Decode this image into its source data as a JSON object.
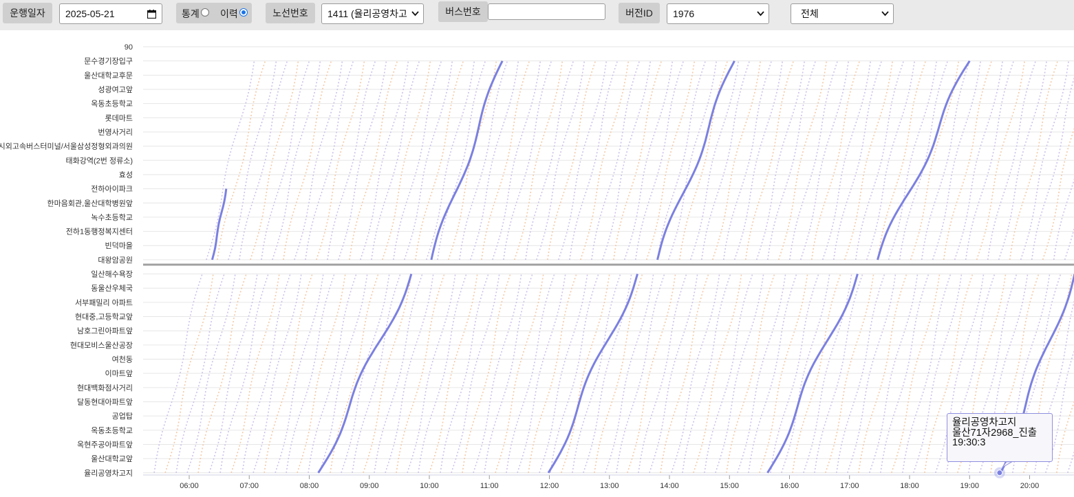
{
  "toolbar": {
    "date_label": "운행일자",
    "date_value": "2025-05-21",
    "stat_label": "통계",
    "history_label": "이력",
    "history_selected": true,
    "route_label": "노선번호",
    "route_value": "1411 (율리공영차고",
    "bus_label": "버스번호",
    "bus_value": "",
    "version_label": "버전ID",
    "version_value": "1976",
    "filter_value": "전체"
  },
  "tooltip": {
    "line1": "율리공영차고지",
    "line2": "울산71자2968_진출",
    "line3": "19:30:3"
  },
  "colors": {
    "highlight": "#7b80e0",
    "faint_purple": "#c7b9e8",
    "faint_orange": "#f3c39c",
    "gridline": "#e6e6e6",
    "divider": "#a0a0a0"
  },
  "chart_data": {
    "type": "line",
    "y_top_label": "90",
    "stops": [
      "문수경기장입구",
      "울산대학교후문",
      "성광여고앞",
      "옥동초등학교",
      "롯데마트",
      "번영사거리",
      "시외고속버스터미널/서울삼성정형외과의원",
      "태화강역(2번 정류소)",
      "효성",
      "전하아이파크",
      "한마음회관,울산대학병원앞",
      "녹수초등학교",
      "전하1동행정복지센터",
      "빈덕마을",
      "대왕암공원",
      "일산해수욕장",
      "동울산우체국",
      "서부패밀리 아파트",
      "현대중,고등학교앞",
      "남호그린아파트앞",
      "현대모비스울산공장",
      "여천동",
      "이마트앞",
      "현대백화점사거리",
      "달동현대아파트앞",
      "공업탑",
      "옥동초등학교",
      "옥현주공아파트앞",
      "울산대학교앞",
      "율리공영차고지"
    ],
    "x_ticks": [
      "06:00",
      "07:00",
      "08:00",
      "09:00",
      "10:00",
      "11:00",
      "12:00",
      "13:00",
      "14:00",
      "15:00",
      "16:00",
      "17:00",
      "18:00",
      "19:00",
      "20:00"
    ],
    "x_range": [
      "05:20",
      "20:45"
    ],
    "highlighted_trips": [
      {
        "start": "08:09",
        "mid": "09:42",
        "end": "11:13"
      },
      {
        "start": "11:59",
        "mid": "13:28",
        "end": "15:05"
      },
      {
        "start": "15:38",
        "mid": "17:08",
        "end": "19:00"
      },
      {
        "start": "19:31",
        "mid": "20:45",
        "end": ""
      }
    ],
    "highlighted_partial": {
      "start": "06:23",
      "end": "06:37"
    },
    "tooltip_point": {
      "stop": "율리공영차고지",
      "time": "19:30:3"
    }
  }
}
